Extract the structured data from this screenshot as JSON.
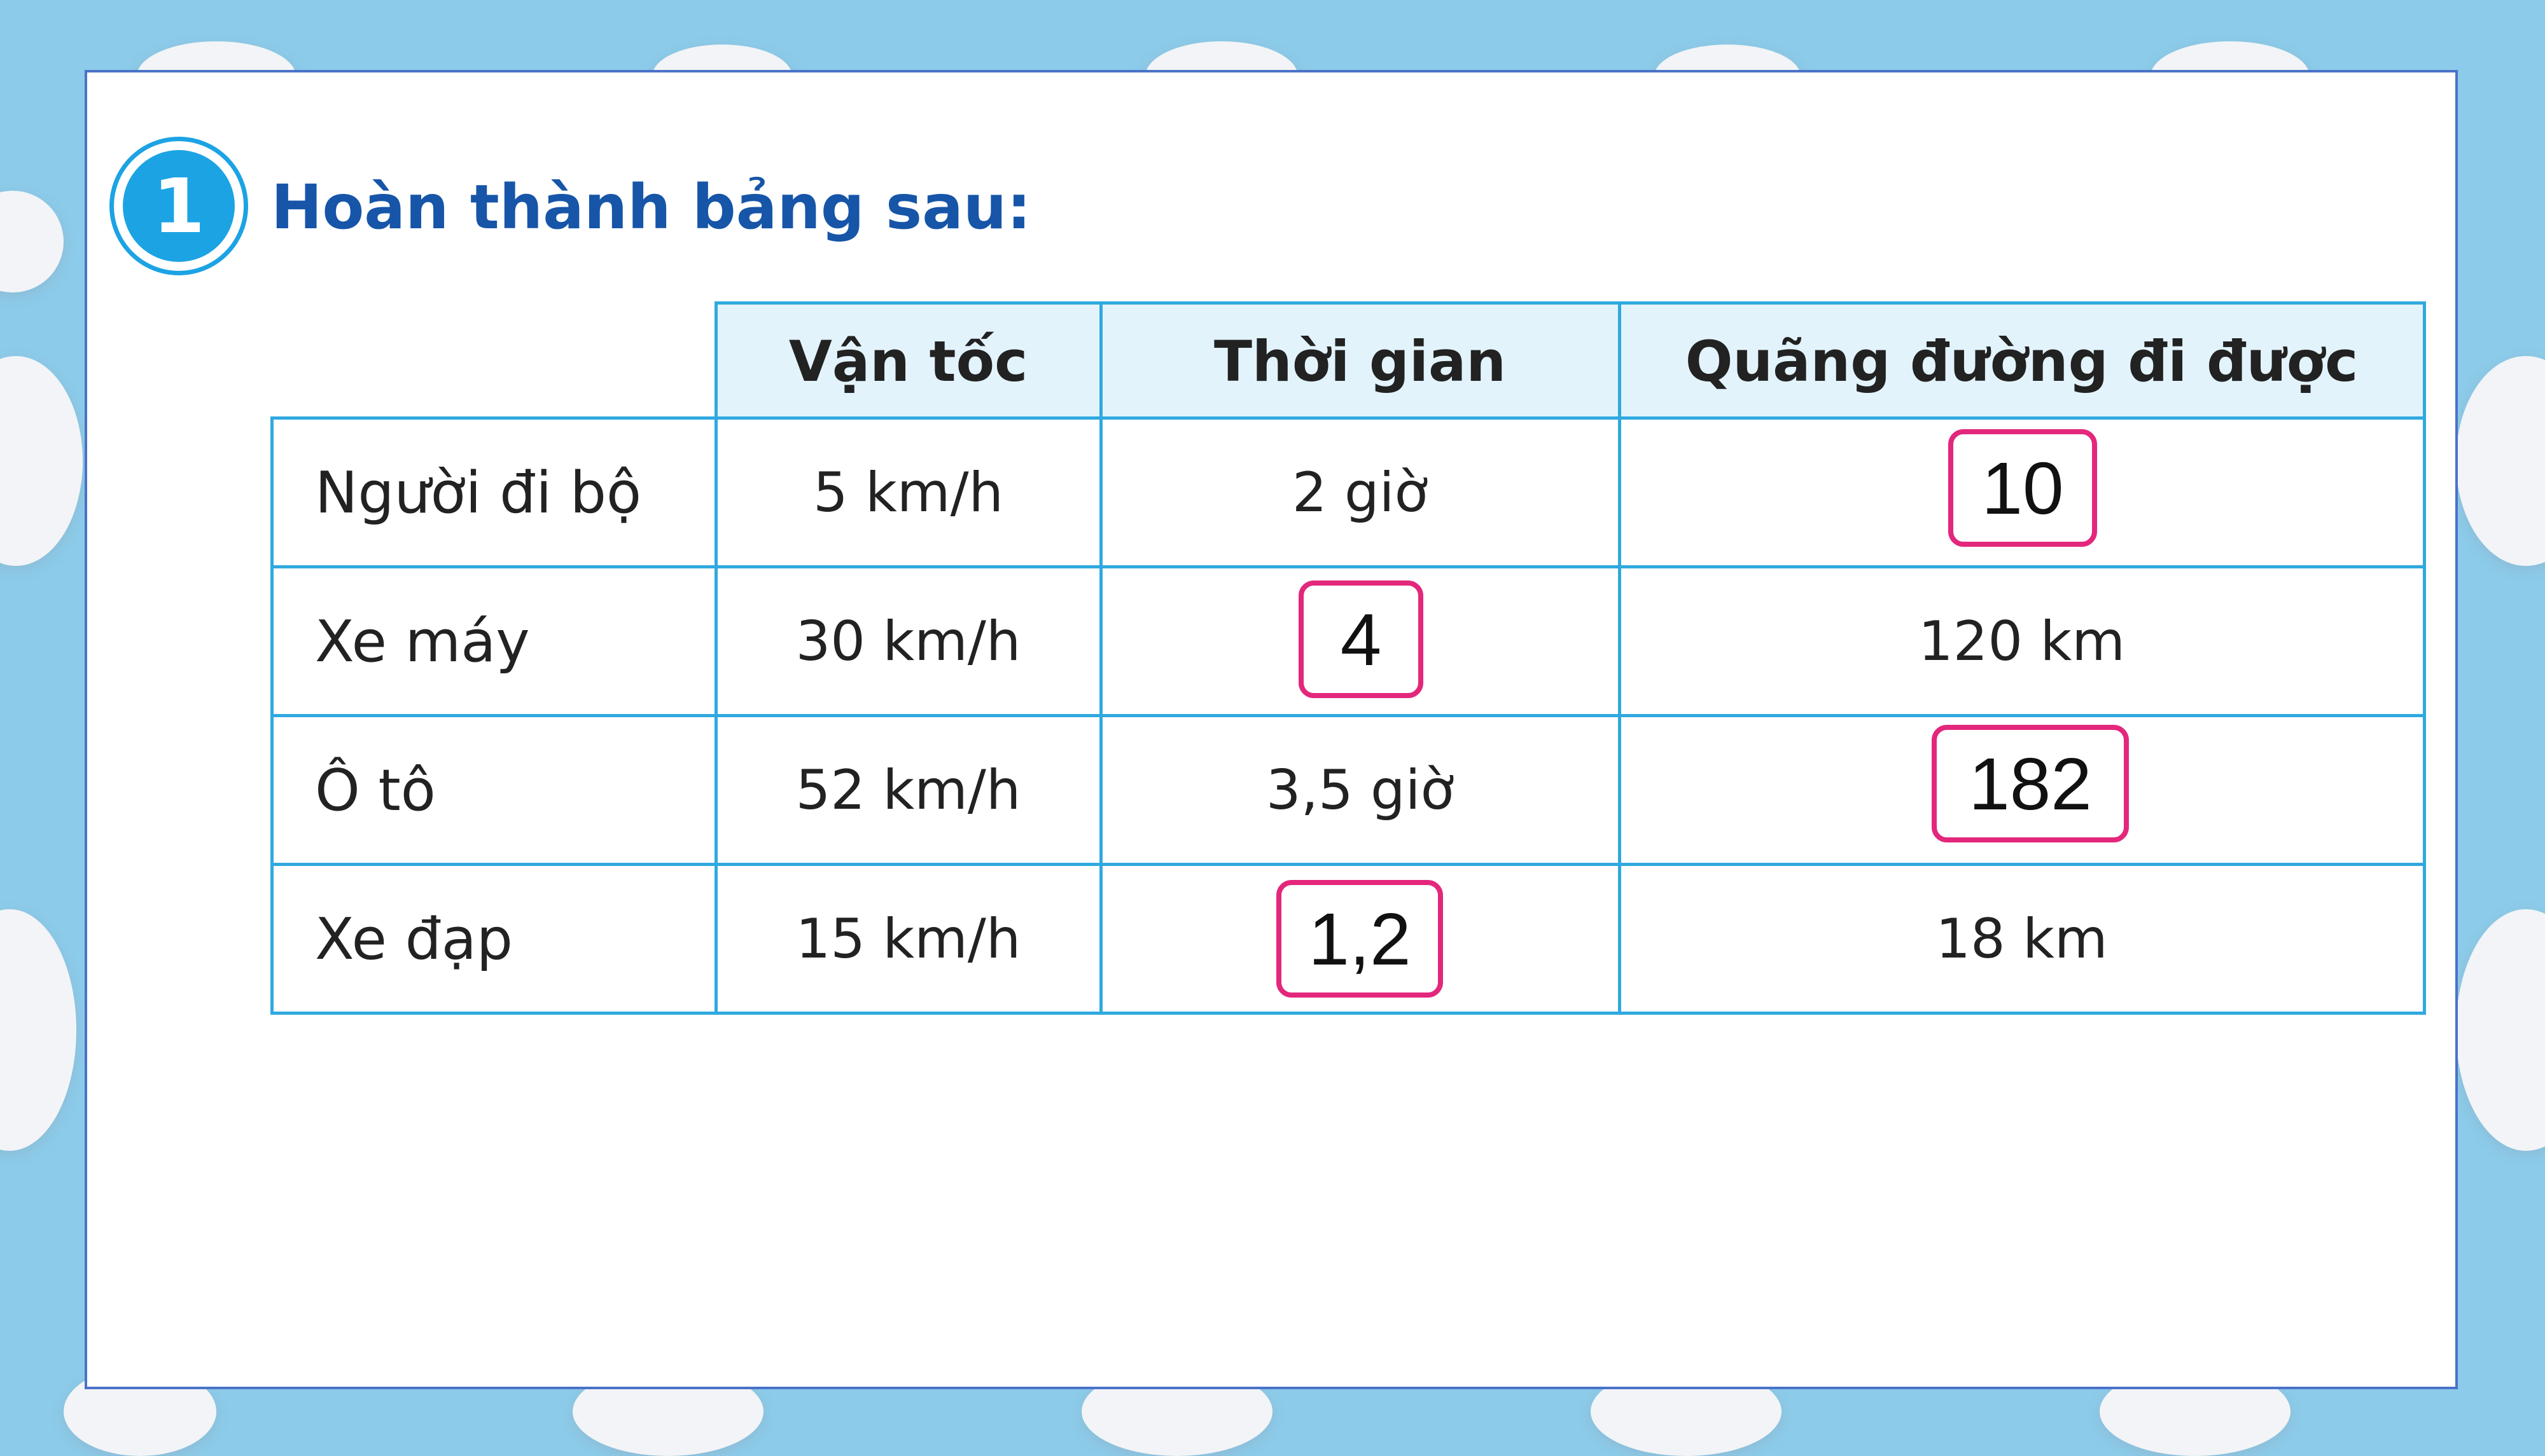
{
  "exercise": {
    "number": "1",
    "title": "Hoàn thành bảng sau:"
  },
  "table": {
    "columns": [
      "",
      "Vận tốc",
      "Thời gian",
      "Quãng đường đi được"
    ],
    "rows": [
      {
        "label": "Người đi bộ",
        "speed": "5 km/h",
        "time": "",
        "distance": "",
        "time_text": "2 giờ",
        "distance_answer": "10"
      },
      {
        "label": "Xe máy",
        "speed": "30 km/h",
        "time_answer": "4",
        "distance_text": "120 km"
      },
      {
        "label": "Ô tô",
        "speed": "52 km/h",
        "time_text": "3,5 giờ",
        "distance_answer": "182"
      },
      {
        "label": "Xe đạp",
        "speed": "15 km/h",
        "time_answer": "1,2",
        "distance_text": "18 km"
      }
    ]
  },
  "colors": {
    "background": "#8ccbe9",
    "panel_border": "#4a73c9",
    "title": "#1655a8",
    "badge": "#1ca3e4",
    "table_line": "#2fa9df",
    "header_fill": "#e2f3fb",
    "answer_border": "#e3277c"
  }
}
